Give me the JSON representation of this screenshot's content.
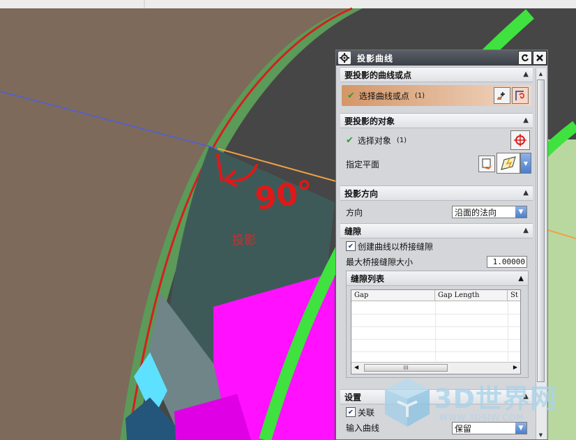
{
  "annotations": {
    "angle": "90°",
    "projection": "投影"
  },
  "dialog": {
    "title": "投影曲线",
    "sections": {
      "curves": {
        "header": "要投影的曲线或点",
        "select_label": "选择曲线或点",
        "select_count": "(1)"
      },
      "objects": {
        "header": "要投影的对象",
        "select_label": "选择对象",
        "select_count": "(1)",
        "plane_label": "指定平面"
      },
      "direction": {
        "header": "投影方向",
        "label": "方向",
        "value": "沿面的法向"
      },
      "gap": {
        "header": "缝隙",
        "create_bridge_label": "创建曲线以桥接缝隙",
        "create_bridge_checked": true,
        "max_gap_label": "最大桥接缝隙大小",
        "max_gap_value": "1.00000",
        "gap_list": {
          "header": "缝隙列表",
          "columns": [
            "Gap",
            "Gap Length",
            "St"
          ],
          "scroll_thumb": "III"
        }
      },
      "settings": {
        "header": "设置",
        "associative_label": "关联",
        "associative_checked": true,
        "input_curve_label": "输入曲线",
        "input_curve_value": "保留"
      }
    }
  },
  "watermark": {
    "brand": "3D世界网",
    "url": "WWW.3DSJW.COM"
  },
  "colors": {
    "accent_row": "#d49668",
    "dropdown_arrow": "#4a7fcc",
    "magenta": "#ff00ff",
    "green_tube": "#3fe23f"
  }
}
